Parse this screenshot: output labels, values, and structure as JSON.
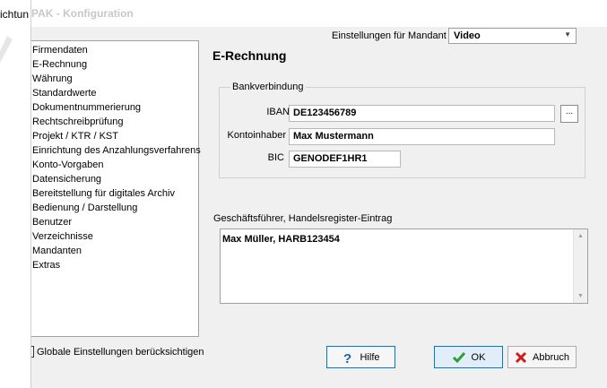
{
  "background_app": {
    "fragment_text": "ichtun"
  },
  "dialog": {
    "title": "PAK - Konfiguration",
    "mandant": {
      "label": "Einstellungen für Mandant",
      "value": "Video"
    },
    "nav_items": [
      "Firmendaten",
      "E-Rechnung",
      "Währung",
      "Standardwerte",
      "Dokumentnummerierung",
      "Rechtschreibprüfung",
      "Projekt / KTR / KST",
      "Einrichtung des Anzahlungsverfahrens",
      "Konto-Vorgaben",
      "Datensicherung",
      "Bereitstellung für digitales Archiv",
      "Bedienung / Darstellung",
      "Benutzer",
      "Verzeichnisse",
      "Mandanten",
      "Extras"
    ],
    "global_settings_label": "Globale Einstellungen berücksichtigen",
    "section_title": "E-Rechnung",
    "bank": {
      "legend": "Bankverbindung",
      "iban_label": "IBAN",
      "iban_value": "DE123456789",
      "browse_label": "...",
      "owner_label": "Kontoinhaber",
      "owner_value": "Max Mustermann",
      "bic_label": "BIC",
      "bic_value": "GENODEF1HR1"
    },
    "register": {
      "label": "Geschäftsführer, Handelsregister-Eintrag",
      "value": "Max Müller, HARB123454"
    },
    "buttons": {
      "help": "Hilfe",
      "ok": "OK",
      "cancel": "Abbruch"
    },
    "icons": {
      "help": "question-icon",
      "ok": "checkmark-icon",
      "cancel": "x-icon"
    },
    "colors": {
      "accent": "#0078d7",
      "ok_icon": "#2e9e2e",
      "cancel_icon": "#d11a1a",
      "help_icon": "#1f5fb0"
    }
  }
}
